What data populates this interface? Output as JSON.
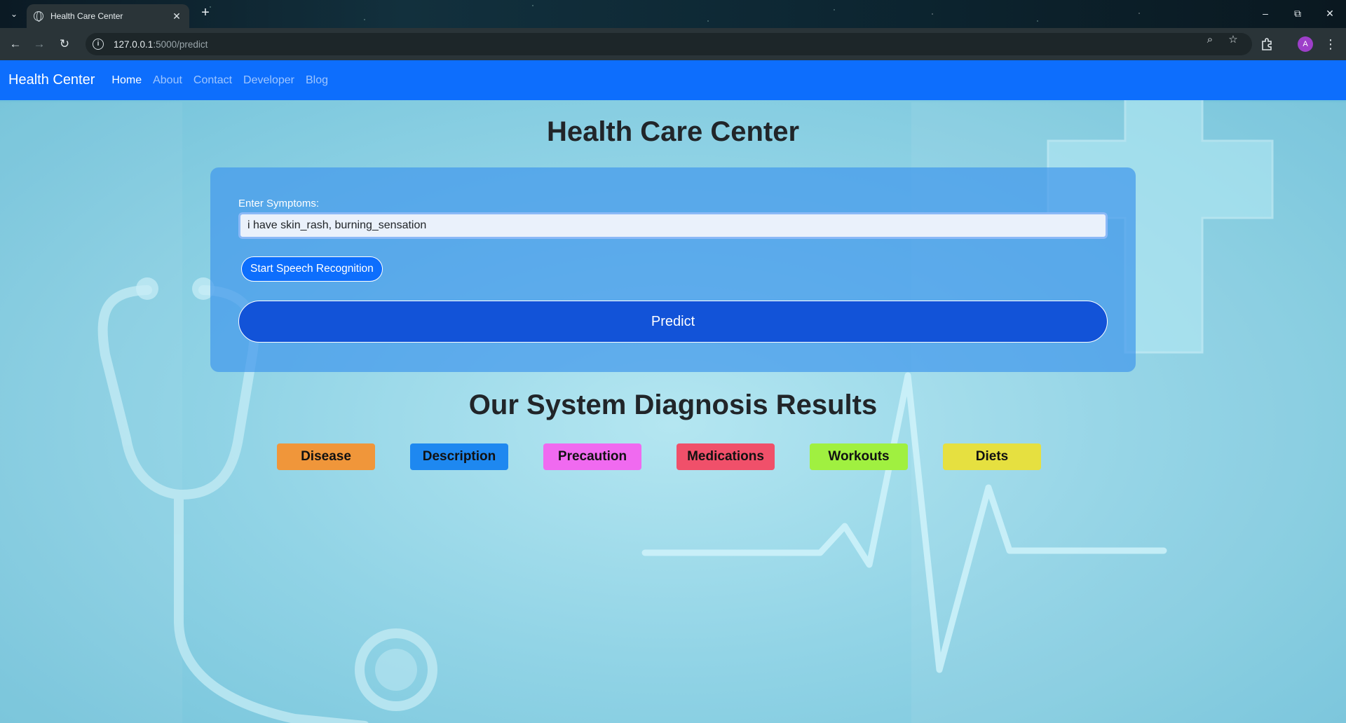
{
  "browser": {
    "tab_title": "Health Care Center",
    "url_host": "127.0.0.1",
    "url_path": ":5000/predict",
    "profile_initial": "A"
  },
  "navbar": {
    "brand": "Health Center",
    "links": [
      "Home",
      "About",
      "Contact",
      "Developer",
      "Blog"
    ],
    "active": "Home"
  },
  "main": {
    "title": "Health Care Center",
    "form": {
      "label": "Enter Symptoms:",
      "input_value": "i have skin_rash, burning_sensation",
      "speech_button": "Start Speech Recognition",
      "predict_button": "Predict"
    },
    "results_title": "Our System Diagnosis Results",
    "result_buttons": [
      {
        "label": "Disease",
        "color": "#f0963a"
      },
      {
        "label": "Description",
        "color": "#1e88f0"
      },
      {
        "label": "Precaution",
        "color": "#f06af0"
      },
      {
        "label": "Medications",
        "color": "#f0506a"
      },
      {
        "label": "Workouts",
        "color": "#a0f040"
      },
      {
        "label": "Diets",
        "color": "#e6e040"
      }
    ]
  },
  "colors": {
    "navbar": "#0d6efd",
    "predict": "#1253d8"
  }
}
